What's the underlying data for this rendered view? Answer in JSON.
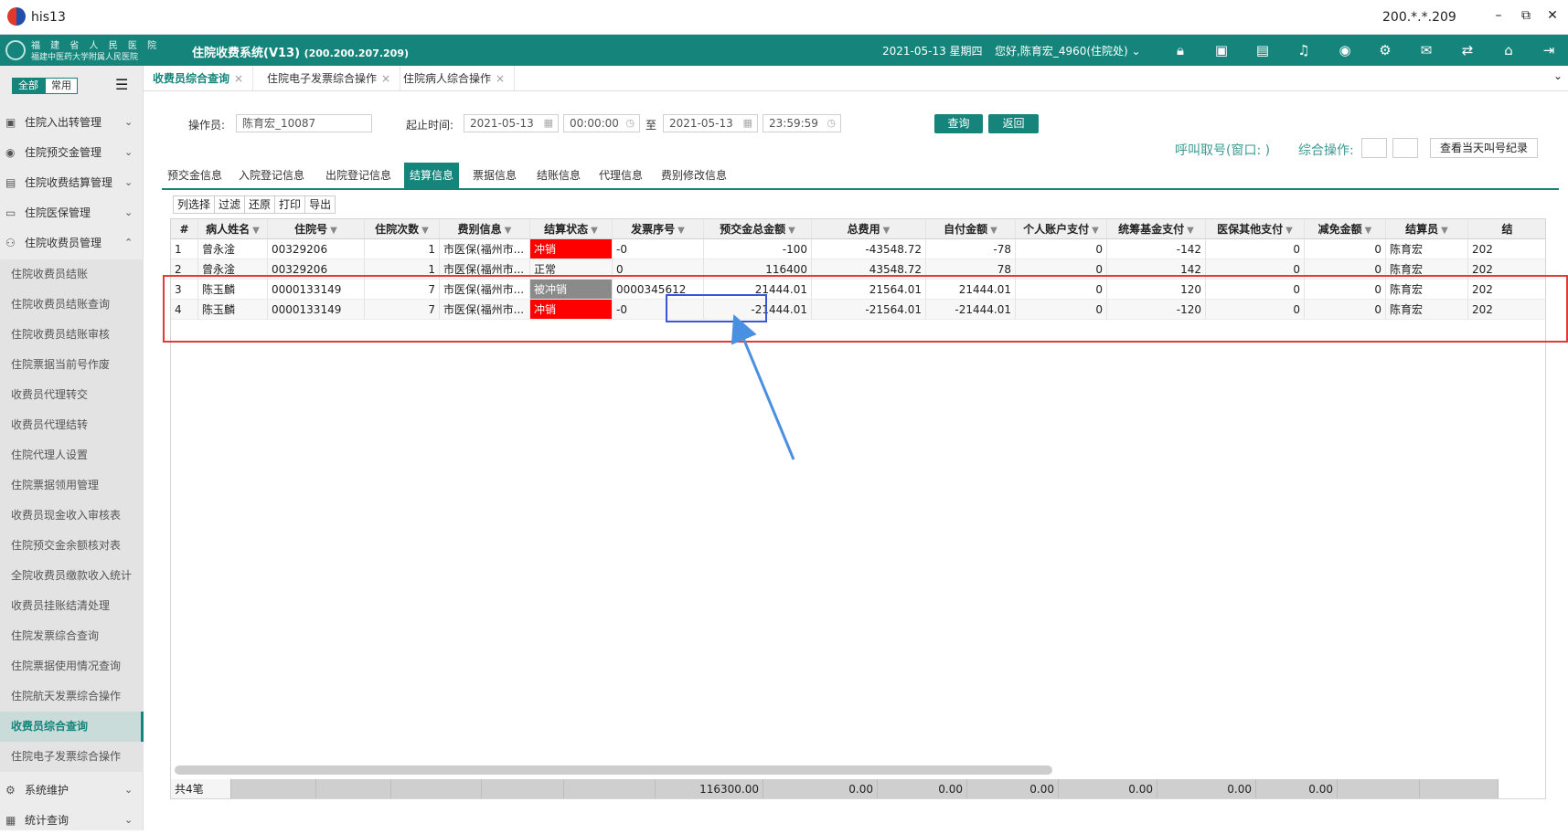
{
  "window": {
    "app_name": "his13",
    "ip": "200.*.*.209",
    "min": "–",
    "max": "⧉",
    "close": "✕"
  },
  "header": {
    "hospital_line1": "福 建 省 人 民 医 院",
    "hospital_line2": "福建中医药大学附属人民医院",
    "system_name": "住院收费系统(V13)",
    "system_ip": "(200.200.207.209)",
    "date": "2021-05-13 星期四",
    "user": "您好,陈育宏_4960(住院处) ⌄",
    "icons": [
      "lock-icon",
      "screen-icon",
      "document-icon",
      "bell-icon",
      "eye-icon",
      "gear-icon",
      "mail-icon",
      "switch-icon",
      "home-icon",
      "logout-icon"
    ]
  },
  "sidebar": {
    "seg_all": "全部",
    "seg_common": "常用",
    "menu_toggle": "☰",
    "groups": [
      {
        "label": "住院入出转管理",
        "icon": "▣",
        "chevron": "⌄"
      },
      {
        "label": "住院预交金管理",
        "icon": "◉",
        "chevron": "⌄"
      },
      {
        "label": "住院收费结算管理",
        "icon": "▤",
        "chevron": "⌄"
      },
      {
        "label": "住院医保管理",
        "icon": "▭",
        "chevron": "⌄"
      },
      {
        "label": "住院收费员管理",
        "icon": "⚇",
        "chevron": "⌃"
      }
    ],
    "sub_items": [
      "住院收费员结账",
      "住院收费员结账查询",
      "住院收费员结账审核",
      "住院票据当前号作废",
      "收费员代理转交",
      "收费员代理结转",
      "住院代理人设置",
      "住院票据领用管理",
      "收费员现金收入审核表",
      "住院预交金余额核对表",
      "全院收费员缴款收入统计",
      "收费员挂账结清处理",
      "住院发票综合查询",
      "住院票据使用情况查询",
      "住院航天发票综合操作",
      "收费员综合查询",
      "住院电子发票综合操作"
    ],
    "active_sub": "收费员综合查询",
    "bottom_groups": [
      {
        "label": "系统维护",
        "icon": "⚙",
        "chevron": "⌄"
      },
      {
        "label": "统计查询",
        "icon": "▦",
        "chevron": "⌄"
      }
    ]
  },
  "tabs": [
    {
      "label": "收费员综合查询",
      "close": "×"
    },
    {
      "label": "住院电子发票综合操作",
      "close": "×"
    },
    {
      "label": "住院病人综合操作",
      "close": "×"
    }
  ],
  "tabs_more": "⌄",
  "filter": {
    "operator_label": "操作员:",
    "operator_value": "陈育宏_10087",
    "time_label": "起止时间:",
    "start_date": "2021-05-13",
    "start_time": "00:00:00",
    "to_label": "至",
    "end_date": "2021-05-13",
    "end_time": "23:59:59",
    "query_button": "查询",
    "back_button": "返回",
    "call_label": "呼叫取号(窗口: )",
    "combined_label": "综合操作:",
    "view_calls_button": "查看当天叫号纪录"
  },
  "subtabs": [
    "预交金信息",
    "入院登记信息",
    "出院登记信息",
    "结算信息",
    "票据信息",
    "结账信息",
    "代理信息",
    "费别修改信息"
  ],
  "active_subtab": "结算信息",
  "toolbar": [
    "列选择",
    "过滤",
    "还原",
    "打印",
    "导出"
  ],
  "table": {
    "columns": [
      "#",
      "病人姓名",
      "住院号",
      "住院次数",
      "费别信息",
      "结算状态",
      "发票序号",
      "预交金总金额",
      "总费用",
      "自付金额",
      "个人账户支付",
      "统筹基金支付",
      "医保其他支付",
      "减免金额",
      "结算员",
      "结"
    ],
    "filter_icon": "▼",
    "rows": [
      [
        "1",
        "曾永淦",
        "00329206",
        "1",
        "市医保(福州市...",
        "冲销",
        "-0",
        "-100",
        "-43548.72",
        "-78",
        "0",
        "-142",
        "0",
        "0",
        "陈育宏",
        "202"
      ],
      [
        "2",
        "曾永淦",
        "00329206",
        "1",
        "市医保(福州市...",
        "正常",
        "0",
        "116400",
        "43548.72",
        "78",
        "0",
        "142",
        "0",
        "0",
        "陈育宏",
        "202"
      ],
      [
        "3",
        "陈玉麟",
        "0000133149",
        "7",
        "市医保(福州市...",
        "被冲销",
        "0000345612",
        "21444.01",
        "21564.01",
        "21444.01",
        "0",
        "120",
        "0",
        "0",
        "陈育宏",
        "202"
      ],
      [
        "4",
        "陈玉麟",
        "0000133149",
        "7",
        "市医保(福州市...",
        "冲销",
        "-0",
        "-21444.01",
        "-21564.01",
        "-21444.01",
        "0",
        "-120",
        "0",
        "0",
        "陈育宏",
        "202"
      ]
    ],
    "status_colors": {
      "冲销": "#fe0000",
      "被冲销": "#8a8a8a",
      "正常": "#ffffff"
    },
    "footer": {
      "count": "共4笔",
      "prepay_total": "116300.00",
      "total_fee": "0.00",
      "self_pay": "0.00",
      "personal": "0.00",
      "pooled": "0.00",
      "other": "0.00",
      "discount": "0.00"
    }
  },
  "colors": {
    "brand": "#15857c",
    "highlight_red": "#e53935",
    "highlight_blue": "#3a56d4",
    "arrow": "#4a90e2"
  }
}
